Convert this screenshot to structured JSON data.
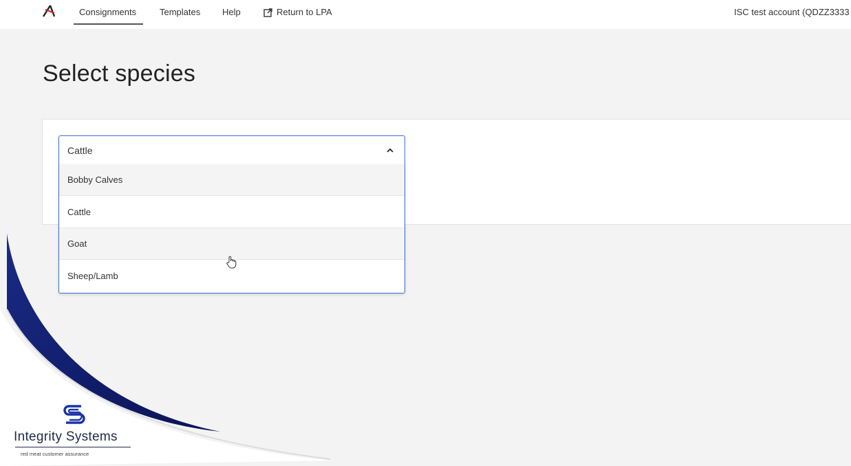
{
  "nav": {
    "items": [
      "Consignments",
      "Templates",
      "Help"
    ],
    "return_label": "Return to LPA",
    "account": "ISC test account (QDZZ3333"
  },
  "page": {
    "title": "Select species"
  },
  "species_select": {
    "selected": "Cattle",
    "options": [
      "Bobby Calves",
      "Cattle",
      "Goat",
      "Sheep/Lamb"
    ]
  },
  "brand": {
    "name": "Integrity Systems",
    "tagline": "red meat customer assurance"
  },
  "colors": {
    "focus_border": "#3d6ec9",
    "brand_navy": "#1f2a44",
    "swoosh_blue": "#14206e"
  },
  "icons": {
    "logo": "app-logo-icon",
    "return": "external-link-icon",
    "chevron": "chevron-up-icon",
    "cursor": "hand-cursor-icon"
  }
}
